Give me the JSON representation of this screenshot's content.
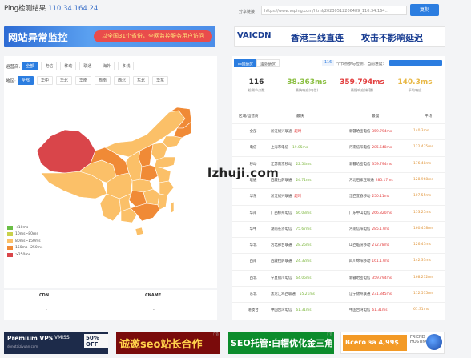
{
  "header": {
    "title": "Ping检测结果",
    "ip": "110.34.164.24",
    "share_label": "分享链接",
    "share_url": "https://www.vsping.com/html/20230512206489_110.34.164...",
    "copy_button": "复制"
  },
  "banners_top": {
    "left_title": "网站异常监控",
    "left_sub": "以全国31个省份，全网监控服务用户访问",
    "right_logo": "VAICDN",
    "right_text1": "香港三线直连",
    "right_text2": "攻击不影响延迟"
  },
  "filters": {
    "isp_label": "运营商:",
    "isp_options": [
      "全部",
      "电信",
      "移动",
      "联通",
      "海外",
      "多线"
    ],
    "isp_active": 0,
    "region_label": "地区:",
    "region_options": [
      "全部",
      "华中",
      "华北",
      "华南",
      "西南",
      "西北",
      "东北",
      "华东"
    ],
    "region_active": 0
  },
  "map": {
    "colors": {
      "lt10": "#6abe45",
      "r10_80": "#c9d14b",
      "r80_150": "#fbc068",
      "r150_250": "#f08a36",
      "gt250": "#d9454a"
    },
    "legend": [
      "<10ms",
      "10ms~80ms",
      "80ms~150ms",
      "150ms~250ms",
      ">250ms"
    ]
  },
  "cdn_table": {
    "headers": [
      "CDN",
      "CNAME"
    ],
    "values": [
      "-",
      "-"
    ]
  },
  "right": {
    "tabs": [
      "中国地区",
      "海外地区"
    ],
    "active_tab": 0,
    "node_count_badge": "116",
    "node_count_text": "个节点参与检测，当前进度:",
    "stats": [
      {
        "value": "116",
        "label": "检测节点数"
      },
      {
        "value": "38.363ms",
        "label": "最快响应(电信)"
      },
      {
        "value": "359.794ms",
        "label": "最慢响应(新疆)"
      },
      {
        "value": "140.3ms",
        "label": "平均响应"
      }
    ],
    "table_headers": [
      "区域/运营商",
      "最快",
      "最慢",
      "平均"
    ],
    "rows": [
      {
        "region": "全部",
        "fast": "浙江绍兴联通",
        "fast_tag": "超时",
        "fast_ms": "",
        "slow": "新疆哈密电信",
        "slow_ms": "359.794ms",
        "avg": "140.3ms"
      },
      {
        "region": "电信",
        "fast": "上海市电信",
        "fast_tag": "",
        "fast_ms": "19.05ms",
        "slow": "河南信阳电信",
        "slow_ms": "285.548ms",
        "avg": "122.435ms"
      },
      {
        "region": "移动",
        "fast": "江苏南京移动",
        "fast_tag": "",
        "fast_ms": "22.54ms",
        "slow": "新疆哈密电信",
        "slow_ms": "359.794ms",
        "avg": "176.48ms"
      },
      {
        "region": "联通",
        "fast": "西藏拉萨联通",
        "fast_tag": "",
        "fast_ms": "24.71ms",
        "slow": "河北石家庄联通",
        "slow_ms": "285.17ms",
        "avg": "128.968ms"
      },
      {
        "region": "华东",
        "fast": "浙江绍兴联通",
        "fast_tag": "超时",
        "fast_ms": "",
        "slow": "江西宜春移动",
        "slow_ms": "250.11ms",
        "avg": "107.55ms"
      },
      {
        "region": "华南",
        "fast": "广西柳州电信",
        "fast_tag": "",
        "fast_ms": "66.03ms",
        "slow": "广东中山电信",
        "slow_ms": "266.820ms",
        "avg": "153.25ms"
      },
      {
        "region": "华中",
        "fast": "湖南长沙电信",
        "fast_tag": "",
        "fast_ms": "75.67ms",
        "slow": "河南信阳电信",
        "slow_ms": "285.17ms",
        "avg": "160.458ms"
      },
      {
        "region": "华北",
        "fast": "河北邢台联通",
        "fast_tag": "",
        "fast_ms": "28.25ms",
        "slow": "山西临汾移动",
        "slow_ms": "272.78ms",
        "avg": "126.47ms"
      },
      {
        "region": "西南",
        "fast": "西藏拉萨联通",
        "fast_tag": "",
        "fast_ms": "24.32ms",
        "slow": "四川绵阳移动",
        "slow_ms": "161.17ms",
        "avg": "142.31ms"
      },
      {
        "region": "西北",
        "fast": "宁夏银川电信",
        "fast_tag": "",
        "fast_ms": "64.05ms",
        "slow": "新疆哈密电信",
        "slow_ms": "359.794ms",
        "avg": "168.212ms"
      },
      {
        "region": "东北",
        "fast": "黑龙江鸡西联通",
        "fast_tag": "",
        "fast_ms": "55.21ms",
        "slow": "辽宁锦州联通",
        "slow_ms": "231.845ms",
        "avg": "112.515ms"
      },
      {
        "region": "港澳台",
        "fast": "中国台湾电信",
        "fast_tag": "",
        "fast_ms": "61.31ms",
        "slow": "中国台湾电信",
        "slow_ms": "61.31ms",
        "avg": "61.31ms"
      }
    ]
  },
  "watermark": "lzhuji.com",
  "bottom_ads": {
    "ad1_title": "Premium VPS",
    "ad1_sub": "dongtaiziyuan.com",
    "ad1_brand": "VMISS",
    "ad1_off": "50% OFF",
    "ad2_text": "诚邀seo站长合作",
    "ad3_text": "SEO托管:白帽优化金三角",
    "ad4_text": "Всего за 4,99$",
    "ad4_brand": "FRIEND HOSTING",
    "ad_tag": "广告"
  }
}
